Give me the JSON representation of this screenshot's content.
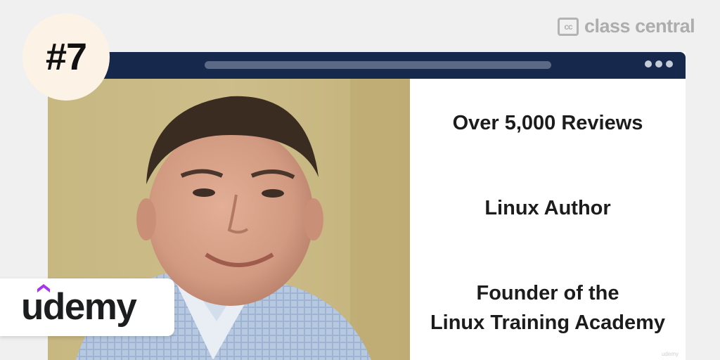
{
  "badge": {
    "rank": "#7"
  },
  "brand": {
    "icon_text": "cc",
    "name": "class central",
    "icon": "class-central-logo-icon"
  },
  "window": {
    "icon": "more-dots-icon"
  },
  "panel": {
    "lines": [
      "Over 5,000 Reviews",
      "Linux Author",
      "Founder of the",
      "Linux Training Academy"
    ],
    "watermark": "udemy"
  },
  "provider": {
    "name": "udemy",
    "icon": "udemy-logo"
  },
  "colors": {
    "titlebar": "#16294d",
    "badge_bg": "#fcf3e6",
    "udemy_accent": "#a435f0",
    "page_bg": "#f0f0f0"
  }
}
